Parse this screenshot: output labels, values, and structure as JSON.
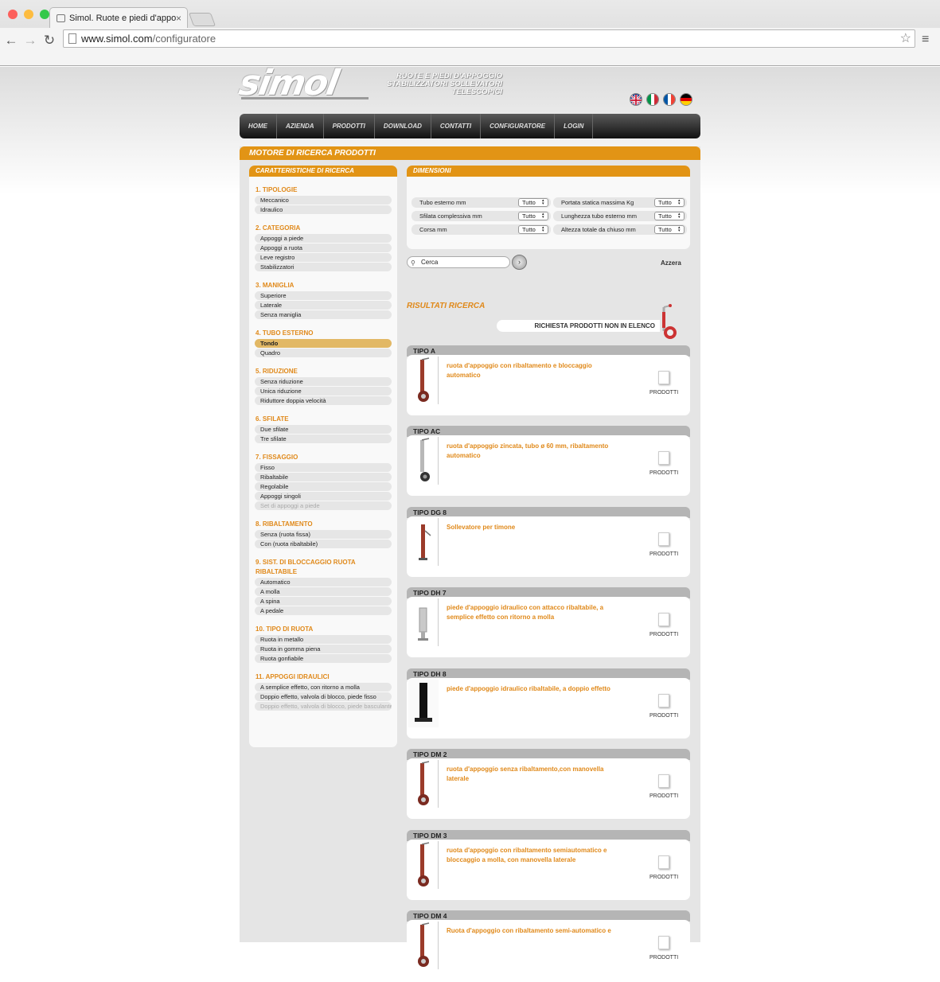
{
  "browser": {
    "tab_title": "Simol. Ruote e piedi d'appo",
    "url_domain": "www.simol.com",
    "url_path": "/configuratore",
    "close_glyph": "×",
    "back_glyph": "←",
    "forward_glyph": "→",
    "reload_glyph": "↻",
    "star_glyph": "☆",
    "menu_glyph": "≡"
  },
  "site": {
    "logo_text": "simol",
    "tagline_lines": [
      "RUOTE E PIEDI D'APPOGGIO",
      "STABILIZZATORI SOLLEVATORI",
      "TELESCOPICI"
    ],
    "languages": [
      "en",
      "it",
      "fr",
      "de"
    ],
    "nav": [
      "HOME",
      "AZIENDA",
      "PRODOTTI",
      "DOWNLOAD",
      "CONTATTI",
      "CONFIGURATORE",
      "LOGIN"
    ]
  },
  "search_engine": {
    "title": "MOTORE DI RICERCA PRODOTTI",
    "filters_title": "CARATTERISTICHE DI RICERCA",
    "groups": [
      {
        "title": "1. TIPOLOGIE",
        "options": [
          {
            "label": "Meccanico"
          },
          {
            "label": "Idraulico"
          }
        ]
      },
      {
        "title": "2. CATEGORIA",
        "options": [
          {
            "label": "Appoggi a piede"
          },
          {
            "label": "Appoggi a ruota"
          },
          {
            "label": "Leve registro"
          },
          {
            "label": "Stabilizzatori"
          }
        ]
      },
      {
        "title": "3. MANIGLIA",
        "options": [
          {
            "label": "Superiore"
          },
          {
            "label": "Laterale"
          },
          {
            "label": "Senza maniglia"
          }
        ]
      },
      {
        "title": "4. TUBO ESTERNO",
        "options": [
          {
            "label": "Tondo",
            "state": "active"
          },
          {
            "label": "Quadro"
          }
        ]
      },
      {
        "title": "5. RIDUZIONE",
        "options": [
          {
            "label": "Senza riduzione"
          },
          {
            "label": "Unica riduzione"
          },
          {
            "label": "Riduttore doppia velocità"
          }
        ]
      },
      {
        "title": "6. SFILATE",
        "options": [
          {
            "label": "Due sfilate"
          },
          {
            "label": "Tre sfilate"
          }
        ]
      },
      {
        "title": "7. FISSAGGIO",
        "options": [
          {
            "label": "Fisso"
          },
          {
            "label": "Ribaltabile"
          },
          {
            "label": "Regolabile"
          },
          {
            "label": "Appoggi singoli"
          },
          {
            "label": "Set di appoggi a piede",
            "state": "disabled"
          }
        ]
      },
      {
        "title": "8. RIBALTAMENTO",
        "options": [
          {
            "label": "Senza (ruota fissa)"
          },
          {
            "label": "Con (ruota ribaltabile)"
          }
        ]
      },
      {
        "title": "9. SIST. DI BLOCCAGGIO RUOTA RIBALTABILE",
        "options": [
          {
            "label": "Automatico"
          },
          {
            "label": "A molla"
          },
          {
            "label": "A spina"
          },
          {
            "label": "A pedale"
          }
        ]
      },
      {
        "title": "10. TIPO DI RUOTA",
        "options": [
          {
            "label": "Ruota in metallo"
          },
          {
            "label": "Ruota in gomma piena"
          },
          {
            "label": "Ruota gonfiabile"
          }
        ]
      },
      {
        "title": "11. APPOGGI IDRAULICI",
        "options": [
          {
            "label": "A semplice effetto, con ritorno a molla"
          },
          {
            "label": "Doppio effetto, valvola di blocco, piede fisso"
          },
          {
            "label": "Doppio effetto, valvola di blocco, piede basculante",
            "state": "disabled"
          }
        ]
      }
    ],
    "dimensions_title": "DIMENSIONI",
    "dimensions": [
      {
        "label": "Tubo esterno mm",
        "value": "Tutto"
      },
      {
        "label": "Portata statica massima Kg",
        "value": "Tutto"
      },
      {
        "label": "Sfilata complessiva mm",
        "value": "Tutto"
      },
      {
        "label": "Lunghezza tubo esterno mm",
        "value": "Tutto"
      },
      {
        "label": "Corsa mm",
        "value": "Tutto"
      },
      {
        "label": "Altezza totale da chiuso mm",
        "value": "Tutto"
      }
    ],
    "search_placeholder": "Cerca",
    "go_glyph": "›",
    "reset_label": "Azzera",
    "results_title": "RISULTATI RICERCA",
    "request_label": "RICHIESTA PRODOTTI NON IN ELENCO",
    "results": [
      {
        "type": "TIPO A",
        "desc": "ruota d'appoggio con ribaltamento e bloccaggio automatico",
        "image": "wheel-jack-red"
      },
      {
        "type": "TIPO AC",
        "desc": "ruota d'appoggio zincata, tubo ø 60 mm, ribaltamento automatico",
        "image": "wheel-jack-zinc"
      },
      {
        "type": "TIPO DG 8",
        "desc": "Sollevatore per timone",
        "image": "drawbar-jack-red"
      },
      {
        "type": "TIPO DH 7",
        "desc": "piede d'appoggio idraulico con attacco ribaltabile, a semplice effetto con ritorno a molla",
        "image": "hydraulic-foot-silver"
      },
      {
        "type": "TIPO DH 8",
        "desc": "piede d'appoggio idraulico ribaltabile, a doppio effetto",
        "image": "hydraulic-foot-black"
      },
      {
        "type": "TIPO DM 2",
        "desc": "ruota d'appoggio senza ribaltamento,con manovella laterale",
        "image": "wheel-jack-red"
      },
      {
        "type": "TIPO DM 3",
        "desc": "ruota d'appoggio con ribaltamento semiautomatico e bloccaggio a molla, con manovella laterale",
        "image": "wheel-jack-red"
      },
      {
        "type": "TIPO DM 4",
        "desc": "Ruota d'appoggio con ribaltamento semi-automatico e",
        "image": "wheel-jack-red"
      }
    ],
    "products_label": "PRODOTTI"
  },
  "colors": {
    "accent": "#e29415",
    "accent_text": "#e0891a",
    "active_option": "#e2b865"
  }
}
